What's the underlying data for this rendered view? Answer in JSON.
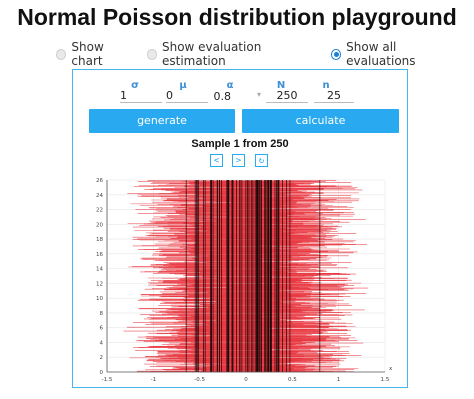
{
  "page": {
    "title": "Normal Poisson distribution playground"
  },
  "view_options": {
    "options": [
      {
        "label": "Show chart",
        "selected": false
      },
      {
        "label": "Show evaluation estimation",
        "selected": false
      },
      {
        "label": "Show all evaluations",
        "selected": true
      }
    ]
  },
  "params": {
    "sigma": {
      "label": "σ",
      "value": "1"
    },
    "mu": {
      "label": "μ",
      "value": "0"
    },
    "alpha": {
      "label": "α",
      "value": "0.8"
    },
    "N": {
      "label": "N",
      "value": "250"
    },
    "n": {
      "label": "n",
      "value": "25"
    }
  },
  "actions": {
    "generate_label": "generate",
    "calculate_label": "calculate"
  },
  "sample": {
    "title": "Sample 1 from 250",
    "prev_label": "<",
    "next_label": ">",
    "reset_label": "↻"
  },
  "colors": {
    "accent": "#29aaf0",
    "interval": "#e8323c",
    "line": "#000000"
  },
  "chart_data": {
    "type": "line",
    "title": "",
    "xlabel": "x",
    "ylabel": "",
    "xlim": [
      -1.5,
      1.5
    ],
    "ylim": [
      0,
      26
    ],
    "x_ticks": [
      "-1.5",
      "-1",
      "-0.5",
      "0",
      "0.5",
      "1",
      "1.5"
    ],
    "y_ticks": [
      "0",
      "2",
      "4",
      "6",
      "8",
      "10",
      "12",
      "14",
      "16",
      "18",
      "20",
      "22",
      "24",
      "26"
    ],
    "grid": true,
    "series_description": "confidence intervals per evaluation (red horizontal) with per-sample estimates (black vertical)",
    "interval_count_per_level": 26,
    "estimate_range": [
      -1.0,
      0.8
    ]
  }
}
